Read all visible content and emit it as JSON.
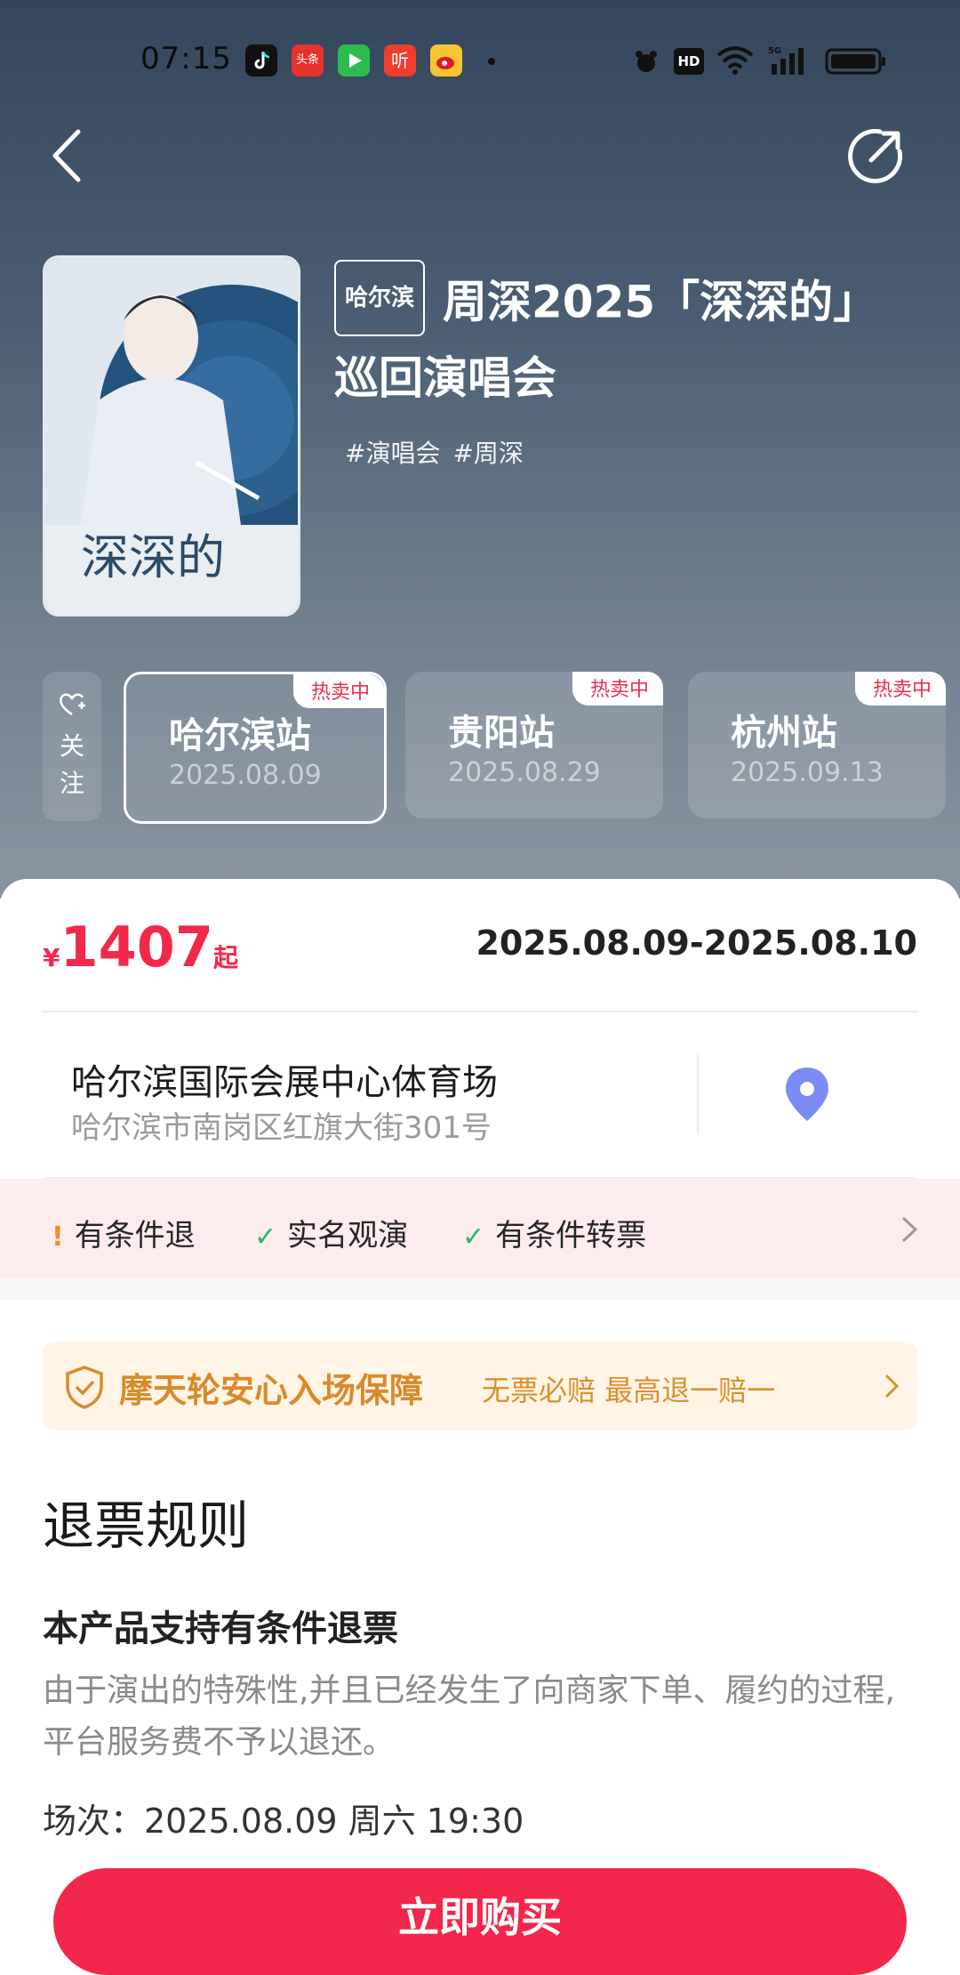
{
  "status_bar": {
    "time": "07:15",
    "apps": [
      "tiktok-icon",
      "toutiao-icon",
      "iqiyi-icon",
      "ting-icon",
      "weibo-icon"
    ],
    "toutiao_label": "头条",
    "ting_label": "听"
  },
  "event": {
    "city_badge": "哈尔滨",
    "title": "周深2025「深深的」巡回演唱会",
    "tags": [
      "#演唱会",
      "#周深"
    ],
    "poster_caption": "深深的"
  },
  "follow": {
    "label_1": "关",
    "label_2": "注"
  },
  "stations": [
    {
      "name": "哈尔滨站",
      "date": "2025.08.09",
      "badge": "热卖中",
      "active": true
    },
    {
      "name": "贵阳站",
      "date": "2025.08.29",
      "badge": "热卖中",
      "active": false
    },
    {
      "name": "杭州站",
      "date": "2025.09.13",
      "badge": "热卖中",
      "active": false
    }
  ],
  "price": {
    "currency": "¥",
    "amount": "1407",
    "suffix": "起"
  },
  "date_range": "2025.08.09-2025.08.10",
  "venue": {
    "name": "哈尔滨国际会展中心体育场",
    "address": "哈尔滨市南岗区红旗大街301号"
  },
  "policies": [
    {
      "mark": "!",
      "label": "有条件退"
    },
    {
      "mark": "✓",
      "label": "实名观演"
    },
    {
      "mark": "✓",
      "label": "有条件转票"
    }
  ],
  "guarantee": {
    "title": "摩天轮安心入场保障",
    "subtitle": "无票必赔 最高退一赔一"
  },
  "refund": {
    "title": "退票规则",
    "subtitle": "本产品支持有条件退票",
    "body": "由于演出的特殊性,并且已经发生了向商家下单、履约的过程,平台服务费不予以退还。",
    "session": "场次：2025.08.09 周六 19:30"
  },
  "buy_button": "立即购买",
  "colors": {
    "accent": "#f2294b",
    "policy_bg": "#fdecee",
    "guarantee": "#d98a2b",
    "pin": "#7b8df2"
  }
}
